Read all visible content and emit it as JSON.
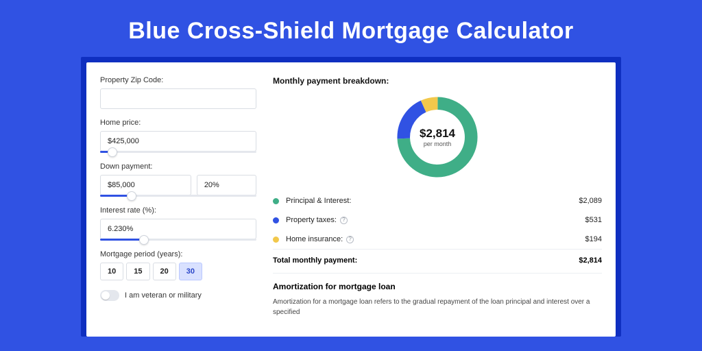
{
  "title": "Blue Cross-Shield Mortgage Calculator",
  "form": {
    "zip": {
      "label": "Property Zip Code:",
      "value": ""
    },
    "home_price": {
      "label": "Home price:",
      "value": "$425,000",
      "slider_pct": 8
    },
    "down_payment": {
      "label": "Down payment:",
      "amount": "$85,000",
      "percent": "20%",
      "slider_pct": 20
    },
    "interest": {
      "label": "Interest rate (%):",
      "value": "6.230%",
      "slider_pct": 28
    },
    "period": {
      "label": "Mortgage period (years):",
      "options": [
        "10",
        "15",
        "20",
        "30"
      ],
      "selected": "30"
    },
    "veteran": {
      "label": "I am veteran or military",
      "on": false
    }
  },
  "breakdown": {
    "heading": "Monthly payment breakdown:",
    "center_amount": "$2,814",
    "center_sub": "per month",
    "items": [
      {
        "key": "principal_interest",
        "label": "Principal & Interest:",
        "value": "$2,089",
        "color": "#3fae87",
        "info": false
      },
      {
        "key": "property_taxes",
        "label": "Property taxes:",
        "value": "$531",
        "color": "#3052e3",
        "info": true
      },
      {
        "key": "home_insurance",
        "label": "Home insurance:",
        "value": "$194",
        "color": "#f2c84b",
        "info": true
      }
    ],
    "total_label": "Total monthly payment:",
    "total_value": "$2,814"
  },
  "amortization": {
    "heading": "Amortization for mortgage loan",
    "body": "Amortization for a mortgage loan refers to the gradual repayment of the loan principal and interest over a specified"
  },
  "chart_data": {
    "type": "pie",
    "title": "Monthly payment breakdown",
    "series": [
      {
        "name": "Principal & Interest",
        "value": 2089,
        "color": "#3fae87"
      },
      {
        "name": "Property taxes",
        "value": 531,
        "color": "#3052e3"
      },
      {
        "name": "Home insurance",
        "value": 194,
        "color": "#f2c84b"
      }
    ],
    "total": 2814,
    "center_label": "$2,814 per month"
  }
}
